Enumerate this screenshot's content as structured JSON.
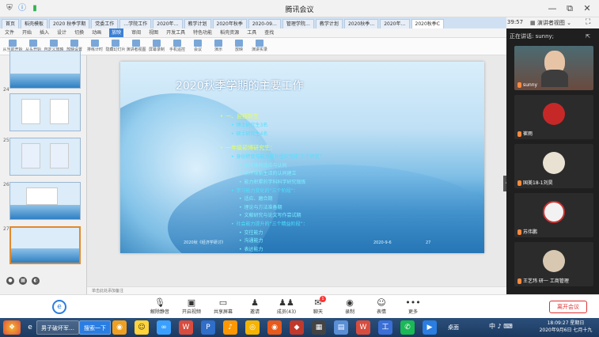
{
  "window": {
    "title": "腾讯会议"
  },
  "ppt": {
    "tabs": [
      "首页",
      "稻壳模板",
      "2020 秋季学期",
      "党委工作",
      "…学院工作",
      "2020年…",
      "教学计划",
      "2020年秋季",
      "2020-09…",
      "管理学院…",
      "教学计划",
      "2020秋季…",
      "2020年…",
      "2020秋季C"
    ],
    "menu": [
      "文件",
      "开始",
      "插入",
      "设计",
      "切换",
      "动画",
      "放映",
      "审阅",
      "视图",
      "开发工具",
      "特色功能",
      "稻壳资源",
      "工具",
      "查找"
    ],
    "active_menu": "放映",
    "ribbon": [
      "从当前开始",
      "从头开始",
      "自定义放映",
      "放映设置",
      "排练计时",
      "隐藏幻灯片",
      "演讲者视图",
      "屏幕录制",
      "手机遥控",
      "会议",
      "演示",
      "放映",
      "演讲实录"
    ],
    "thumb_numbers": [
      "24",
      "25",
      "26",
      "27"
    ],
    "note_text": "单击此处添加备注"
  },
  "slide": {
    "title": "2020秋季学期的主要工作",
    "lines": [
      {
        "level": 1,
        "text": "一、迎接新生"
      },
      {
        "level": 2,
        "text": "博士研究生3名"
      },
      {
        "level": 2,
        "text": "硕士研究生4名"
      },
      {
        "level": 1,
        "text": "一年级硕博研究生："
      },
      {
        "level": 2,
        "text": "身份转变与能力提升适应完成“三个转变”"
      },
      {
        "level": 3,
        "text": "新环境的适应与认同"
      },
      {
        "level": 3,
        "text": "新环境新生活的认同建立"
      },
      {
        "level": 3,
        "text": "能力积累的学科科学研究锻炼"
      },
      {
        "level": 2,
        "text": "学习能力变化的“三个阶段”："
      },
      {
        "level": 3,
        "text": "适应、磨合期"
      },
      {
        "level": 3,
        "text": "理论与方法准备期"
      },
      {
        "level": 3,
        "text": "文献研究与论文写作尝试期"
      },
      {
        "level": 2,
        "text": "社会能力提升的“三个精益阶段”："
      },
      {
        "level": 3,
        "text": "交往能力"
      },
      {
        "level": 3,
        "text": "沟通能力"
      },
      {
        "level": 3,
        "text": "表达能力"
      }
    ],
    "footer_left": "2020秋《经济学研讨》",
    "footer_date": "2020-9-6",
    "footer_page": "27"
  },
  "meeting": {
    "time": "39:57",
    "view_label": "演讲者视图",
    "speaking_label": "正在讲话: sunny;",
    "participants": [
      {
        "name": "sunny"
      },
      {
        "name": "崔雨"
      },
      {
        "name": "国美18-1刘昊"
      },
      {
        "name": "苏伟鹏"
      },
      {
        "name": "王艺玮 研一 工商管理"
      }
    ]
  },
  "controls": [
    {
      "label": "解除静音",
      "icon": "mic-off-icon"
    },
    {
      "label": "开启视频",
      "icon": "camera-off-icon"
    },
    {
      "label": "共享屏幕",
      "icon": "share-screen-icon"
    },
    {
      "label": "邀请",
      "icon": "invite-icon"
    },
    {
      "label": "成员(43)",
      "icon": "members-icon"
    },
    {
      "label": "聊天",
      "icon": "chat-icon",
      "badge": "1"
    },
    {
      "label": "录制",
      "icon": "record-icon"
    },
    {
      "label": "表情",
      "icon": "emoji-icon"
    },
    {
      "label": "更多",
      "icon": "more-icon"
    }
  ],
  "end_meeting": "离开会议",
  "taskbar": {
    "browser_task": "男子破坏军…",
    "search_btn": "搜索一下",
    "desktop": "桌面",
    "time": "18:09:27 星期日",
    "date": "2020年9月6日 七月十九"
  }
}
